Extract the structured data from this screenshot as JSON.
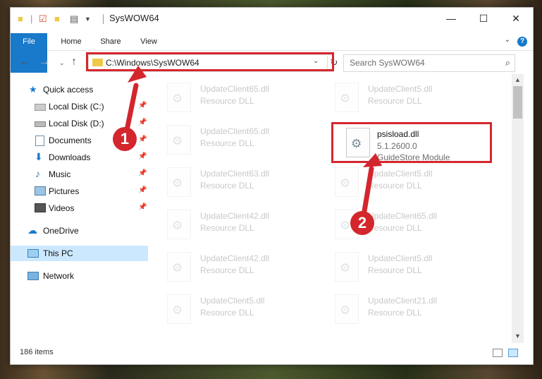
{
  "window": {
    "title": "SysWOW64",
    "controls": {
      "minimize": "—",
      "maximize": "☐",
      "close": "✕"
    }
  },
  "ribbon": {
    "tabs": [
      "File",
      "Home",
      "Share",
      "View"
    ],
    "help": "?"
  },
  "address_bar": {
    "path": "C:\\Windows\\SysWOW64",
    "refresh_icon": "refresh-icon"
  },
  "search": {
    "placeholder": "Search SysWOW64"
  },
  "nav": {
    "items": [
      {
        "label": "Quick access",
        "icon": "star-icon",
        "pinned": false
      },
      {
        "label": "Local Disk (C:)",
        "icon": "drive-icon",
        "pinned": true
      },
      {
        "label": "Local Disk (D:)",
        "icon": "drive-icon",
        "pinned": true
      },
      {
        "label": "Documents",
        "icon": "documents-icon",
        "pinned": true
      },
      {
        "label": "Downloads",
        "icon": "download-icon",
        "pinned": true
      },
      {
        "label": "Music",
        "icon": "music-icon",
        "pinned": true
      },
      {
        "label": "Pictures",
        "icon": "pictures-icon",
        "pinned": true
      },
      {
        "label": "Videos",
        "icon": "videos-icon",
        "pinned": true
      },
      {
        "label": "OneDrive",
        "icon": "cloud-icon",
        "pinned": false
      },
      {
        "label": "This PC",
        "icon": "monitor-icon",
        "pinned": false,
        "selected": true
      },
      {
        "label": "Network",
        "icon": "network-icon",
        "pinned": false
      }
    ]
  },
  "files": [
    {
      "name": "UpdateClient65.dll",
      "desc": "Resource DLL",
      "faded": true
    },
    {
      "name": "UpdateClient5.dll",
      "desc": "Resource DLL",
      "faded": true
    },
    {
      "name": "UpdateClient65.dll",
      "desc": "Resource DLL",
      "faded": true
    },
    {
      "name": "psisload.dll",
      "version": "5.1.2600.0",
      "desc": "GuideStore Module",
      "faded": false
    },
    {
      "name": "UpdateClient63.dll",
      "desc": "Resource DLL",
      "faded": true
    },
    {
      "name": "UpdateClient5.dll",
      "desc": "Resource DLL",
      "faded": true
    },
    {
      "name": "UpdateClient42.dll",
      "desc": "Resource DLL",
      "faded": true
    },
    {
      "name": "UpdateClient65.dll",
      "desc": "Resource DLL",
      "faded": true
    },
    {
      "name": "UpdateClient42.dll",
      "desc": "Resource DLL",
      "faded": true
    },
    {
      "name": "UpdateClient5.dll",
      "desc": "Resource DLL",
      "faded": true
    },
    {
      "name": "UpdateClient5.dll",
      "desc": "Resource DLL",
      "faded": true
    },
    {
      "name": "UpdateClient21.dll",
      "desc": "Resource DLL",
      "faded": true
    }
  ],
  "status": {
    "item_count": "186 items"
  },
  "callouts": {
    "step1": "1",
    "step2": "2"
  },
  "colors": {
    "accent": "#1979ca",
    "highlight": "#d6262d",
    "selection": "#cce8ff"
  }
}
